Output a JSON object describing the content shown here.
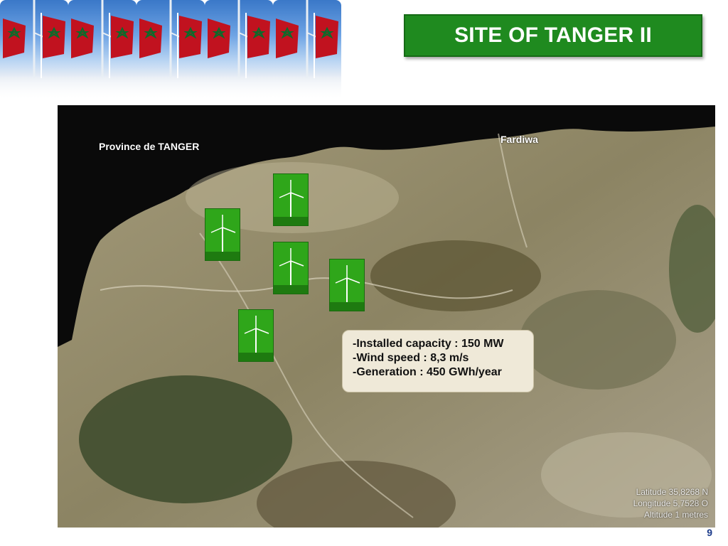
{
  "slide": {
    "title": "SITE OF TANGER II",
    "page_number": "9"
  },
  "map": {
    "labels": {
      "province": "Province de TANGER",
      "fardiwa": "Fardiwa"
    },
    "info": {
      "lines": [
        "-Installed capacity : 150 MW",
        "-Wind speed : 8,3 m/s",
        "-Generation : 450 GWh/year"
      ]
    },
    "coordinates": {
      "latitude": "Latitude 35,8268 N",
      "longitude": "Longitude 5,7528 O",
      "altitude": "Altitude 1 metres"
    }
  },
  "icons": {
    "banner": "flag-wind-turbine-banner",
    "turbine": "wind-turbine-icon"
  },
  "colors": {
    "title_bg": "#1f8a1f",
    "turbine_bg": "#2fa61a",
    "flag_red": "#c1121f",
    "flag_star": "#0b6b2b",
    "page_number": "#1a3a8a"
  }
}
